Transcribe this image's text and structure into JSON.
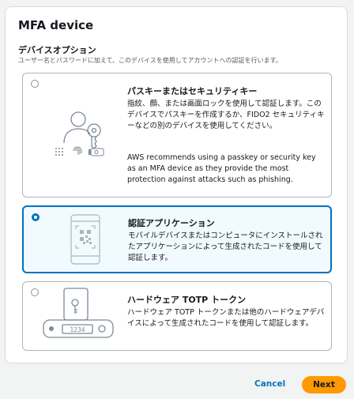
{
  "panel": {
    "title": "MFA device",
    "section_title": "デバイスオプション",
    "section_description": "ユーザー名とパスワードに加えて、このデバイスを使用してアカウントへの認証を行います。"
  },
  "options": [
    {
      "id": "passkey",
      "title": "パスキーまたはセキュリティキー",
      "description": "指紋、顔、または画面ロックを使用して認証します。このデバイスでパスキーを作成するか、FIDO2 セキュリティキーなどの別のデバイスを使用してください。",
      "note": "AWS recommends using a passkey or security key as an MFA device as they provide the most protection against attacks such as phishing.",
      "selected": false,
      "icon": "passkey-person-key-icon"
    },
    {
      "id": "authenticator",
      "title": "認証アプリケーション",
      "description": "モバイルデバイスまたはコンピュータにインストールされたアプリケーションによって生成されたコードを使用して認証します。",
      "selected": true,
      "icon": "phone-qr-code-icon"
    },
    {
      "id": "hardware-totp",
      "title": "ハードウェア TOTP トークン",
      "description": "ハードウェア TOTP トークンまたは他のハードウェアデバイスによって生成されたコードを使用して認証します。",
      "selected": false,
      "icon": "hardware-token-icon",
      "token_display": "1234"
    }
  ],
  "footer": {
    "cancel_label": "Cancel",
    "next_label": "Next"
  },
  "colors": {
    "accent": "#0073bb",
    "primary_button": "#ff9900",
    "selected_background": "#f1faff"
  }
}
